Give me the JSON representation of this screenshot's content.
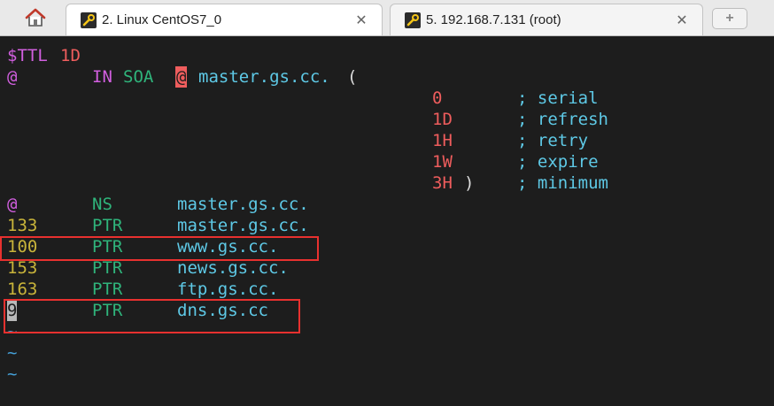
{
  "tabs": [
    {
      "label": "2. Linux CentOS7_0",
      "active": true,
      "close": "✕"
    },
    {
      "label": "5. 192.168.7.131 (root)",
      "active": false,
      "close": "✕"
    }
  ],
  "new_tab_symbol": "+",
  "zone": {
    "ttl_directive": "$TTL",
    "ttl_value": "1D",
    "soa": {
      "origin": "@",
      "class": "IN",
      "type": "SOA",
      "rname": "@",
      "mname": "master.gs.cc.",
      "open_paren": "(",
      "close_paren": ")",
      "fields": [
        {
          "value": "0",
          "comment": "; serial"
        },
        {
          "value": "1D",
          "comment": "; refresh"
        },
        {
          "value": "1H",
          "comment": "; retry"
        },
        {
          "value": "1W",
          "comment": "; expire"
        },
        {
          "value": "3H",
          "comment": "; minimum"
        }
      ]
    },
    "records": [
      {
        "name": "@",
        "type": "NS",
        "data": "master.gs.cc."
      },
      {
        "name": "133",
        "type": "PTR",
        "data": "master.gs.cc."
      },
      {
        "name": "100",
        "type": "PTR",
        "data": "www.gs.cc."
      },
      {
        "name": "153",
        "type": "PTR",
        "data": "news.gs.cc."
      },
      {
        "name": "163",
        "type": "PTR",
        "data": "ftp.gs.cc."
      },
      {
        "name": "9",
        "type": "PTR",
        "data": "dns.gs.cc"
      }
    ],
    "empty_line_marker": "~"
  },
  "colors": {
    "terminal_bg": "#1d1d1d",
    "magenta": "#d25fe0",
    "red": "#ef5d5d",
    "green": "#2fb47b",
    "cyan": "#5ec9e6",
    "yellow": "#c9b43a",
    "highlight_box": "#e8312f"
  },
  "icons": {
    "home": "home-icon",
    "tab": "wrench-icon",
    "close": "close-icon",
    "new_tab": "plus-icon"
  }
}
